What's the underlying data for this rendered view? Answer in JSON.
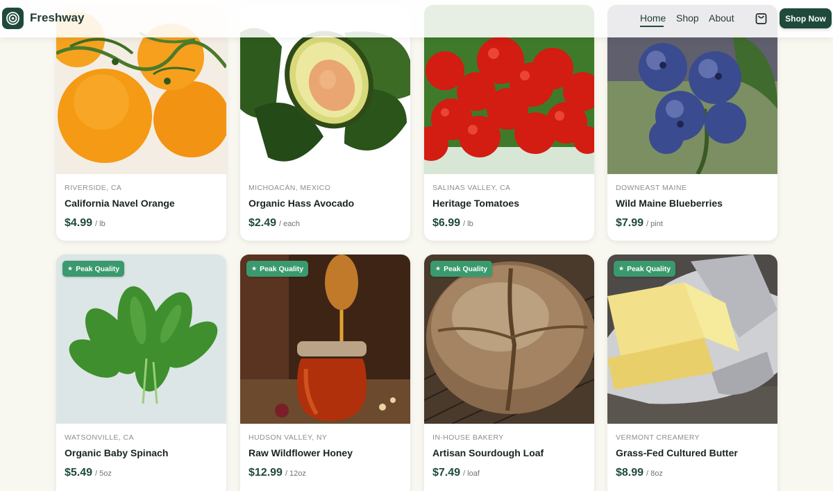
{
  "brand": {
    "name": "Freshway",
    "logo_icon": "target-icon"
  },
  "nav": {
    "items": [
      "Home",
      "Shop",
      "About"
    ],
    "active": "Home",
    "cart_icon": "shopping-bag-icon",
    "cta_label": "Shop Now"
  },
  "colors": {
    "primary": "#1f4a3b",
    "badge": "#3a9a6d",
    "background": "#f8f7f0"
  },
  "products": [
    {
      "origin": "RIVERSIDE, CA",
      "name": "California Navel Orange",
      "price": "$4.99",
      "unit": "/ lb",
      "badge": "",
      "image": "oranges"
    },
    {
      "origin": "MICHOACÁN, MEXICO",
      "name": "Organic Hass Avocado",
      "price": "$2.49",
      "unit": "/ each",
      "badge": "",
      "image": "avocado"
    },
    {
      "origin": "SALINAS VALLEY, CA",
      "name": "Heritage Tomatoes",
      "price": "$6.99",
      "unit": "/ lb",
      "badge": "",
      "image": "tomatoes"
    },
    {
      "origin": "DOWNEAST MAINE",
      "name": "Wild Maine Blueberries",
      "price": "$7.99",
      "unit": "/ pint",
      "badge": "",
      "image": "blueberries"
    },
    {
      "origin": "WATSONVILLE, CA",
      "name": "Organic Baby Spinach",
      "price": "$5.49",
      "unit": "/ 5oz",
      "badge": "Peak Quality",
      "image": "spinach"
    },
    {
      "origin": "HUDSON VALLEY, NY",
      "name": "Raw Wildflower Honey",
      "price": "$12.99",
      "unit": "/ 12oz",
      "badge": "Peak Quality",
      "image": "honey"
    },
    {
      "origin": "IN-HOUSE BAKERY",
      "name": "Artisan Sourdough Loaf",
      "price": "$7.49",
      "unit": "/ loaf",
      "badge": "Peak Quality",
      "image": "sourdough"
    },
    {
      "origin": "VERMONT CREAMERY",
      "name": "Grass-Fed Cultured Butter",
      "price": "$8.99",
      "unit": "/ 8oz",
      "badge": "Peak Quality",
      "image": "butter"
    }
  ]
}
